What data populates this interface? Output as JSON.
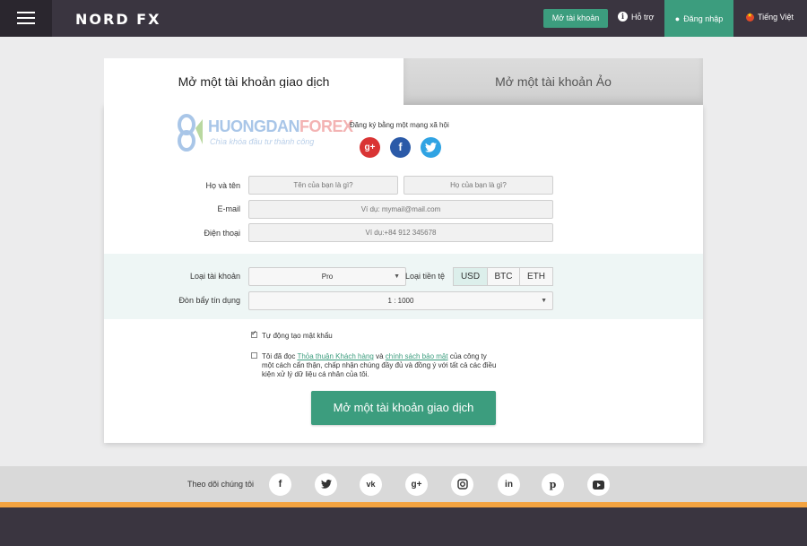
{
  "header": {
    "logo": "NORD FX",
    "open_account": "Mở tài khoản",
    "support": "Hỗ trợ",
    "login": "Đăng nhập",
    "language": "Tiếng Việt"
  },
  "tabs": {
    "live": "Mở một tài khoản giao dịch",
    "demo": "Mở một tài khoản Ảo"
  },
  "watermark": {
    "brand_a": "HUONGDAN",
    "brand_b": "FOREX",
    "tagline": "Chìa khóa đầu tư thành công"
  },
  "social": {
    "title": "Đăng ký bằng một mạng xã hội",
    "google": "g+",
    "facebook": "f",
    "twitter": "t"
  },
  "form": {
    "name_label": "Họ và tên",
    "first_name_placeholder": "Tên của bạn là gì?",
    "last_name_placeholder": "Họ của bạn là gì?",
    "email_label": "E-mail",
    "email_placeholder": "Ví dụ: mymail@mail.com",
    "phone_label": "Điện thoại",
    "phone_placeholder": "Ví dụ:+84 912 345678",
    "account_type_label": "Loại tài khoản",
    "account_type_value": "Pro",
    "currency_label": "Loại tiền tệ",
    "currencies": [
      "USD",
      "BTC",
      "ETH"
    ],
    "selected_currency": "USD",
    "leverage_label": "Đòn bẩy tín dụng",
    "leverage_value": "1 : 1000",
    "auto_password": "Tự động tạo mật khẩu",
    "auto_password_checked": true,
    "agree_prefix": "Tôi đã đọc",
    "agree_link1": "Thỏa thuận Khách hàng",
    "agree_and": "và",
    "agree_link2": "chính sách bảo mật",
    "agree_rest": "của công ty một cách cẩn thận, chấp nhận chúng đầy đủ và đồng ý với tất cả các điều kiện xử lý dữ liệu cá nhân của tôi.",
    "agree_checked": false,
    "submit": "Mở một tài khoản giao dịch"
  },
  "footer": {
    "follow": "Theo dõi chúng tôi",
    "icons": [
      "facebook-icon",
      "twitter-icon",
      "vk-icon",
      "google-plus-icon",
      "instagram-icon",
      "linkedin-icon",
      "pinterest-icon",
      "youtube-icon"
    ]
  },
  "colors": {
    "header_bg": "#3a3540",
    "accent": "#3c9d7e",
    "footer_orange": "#f3a340"
  }
}
